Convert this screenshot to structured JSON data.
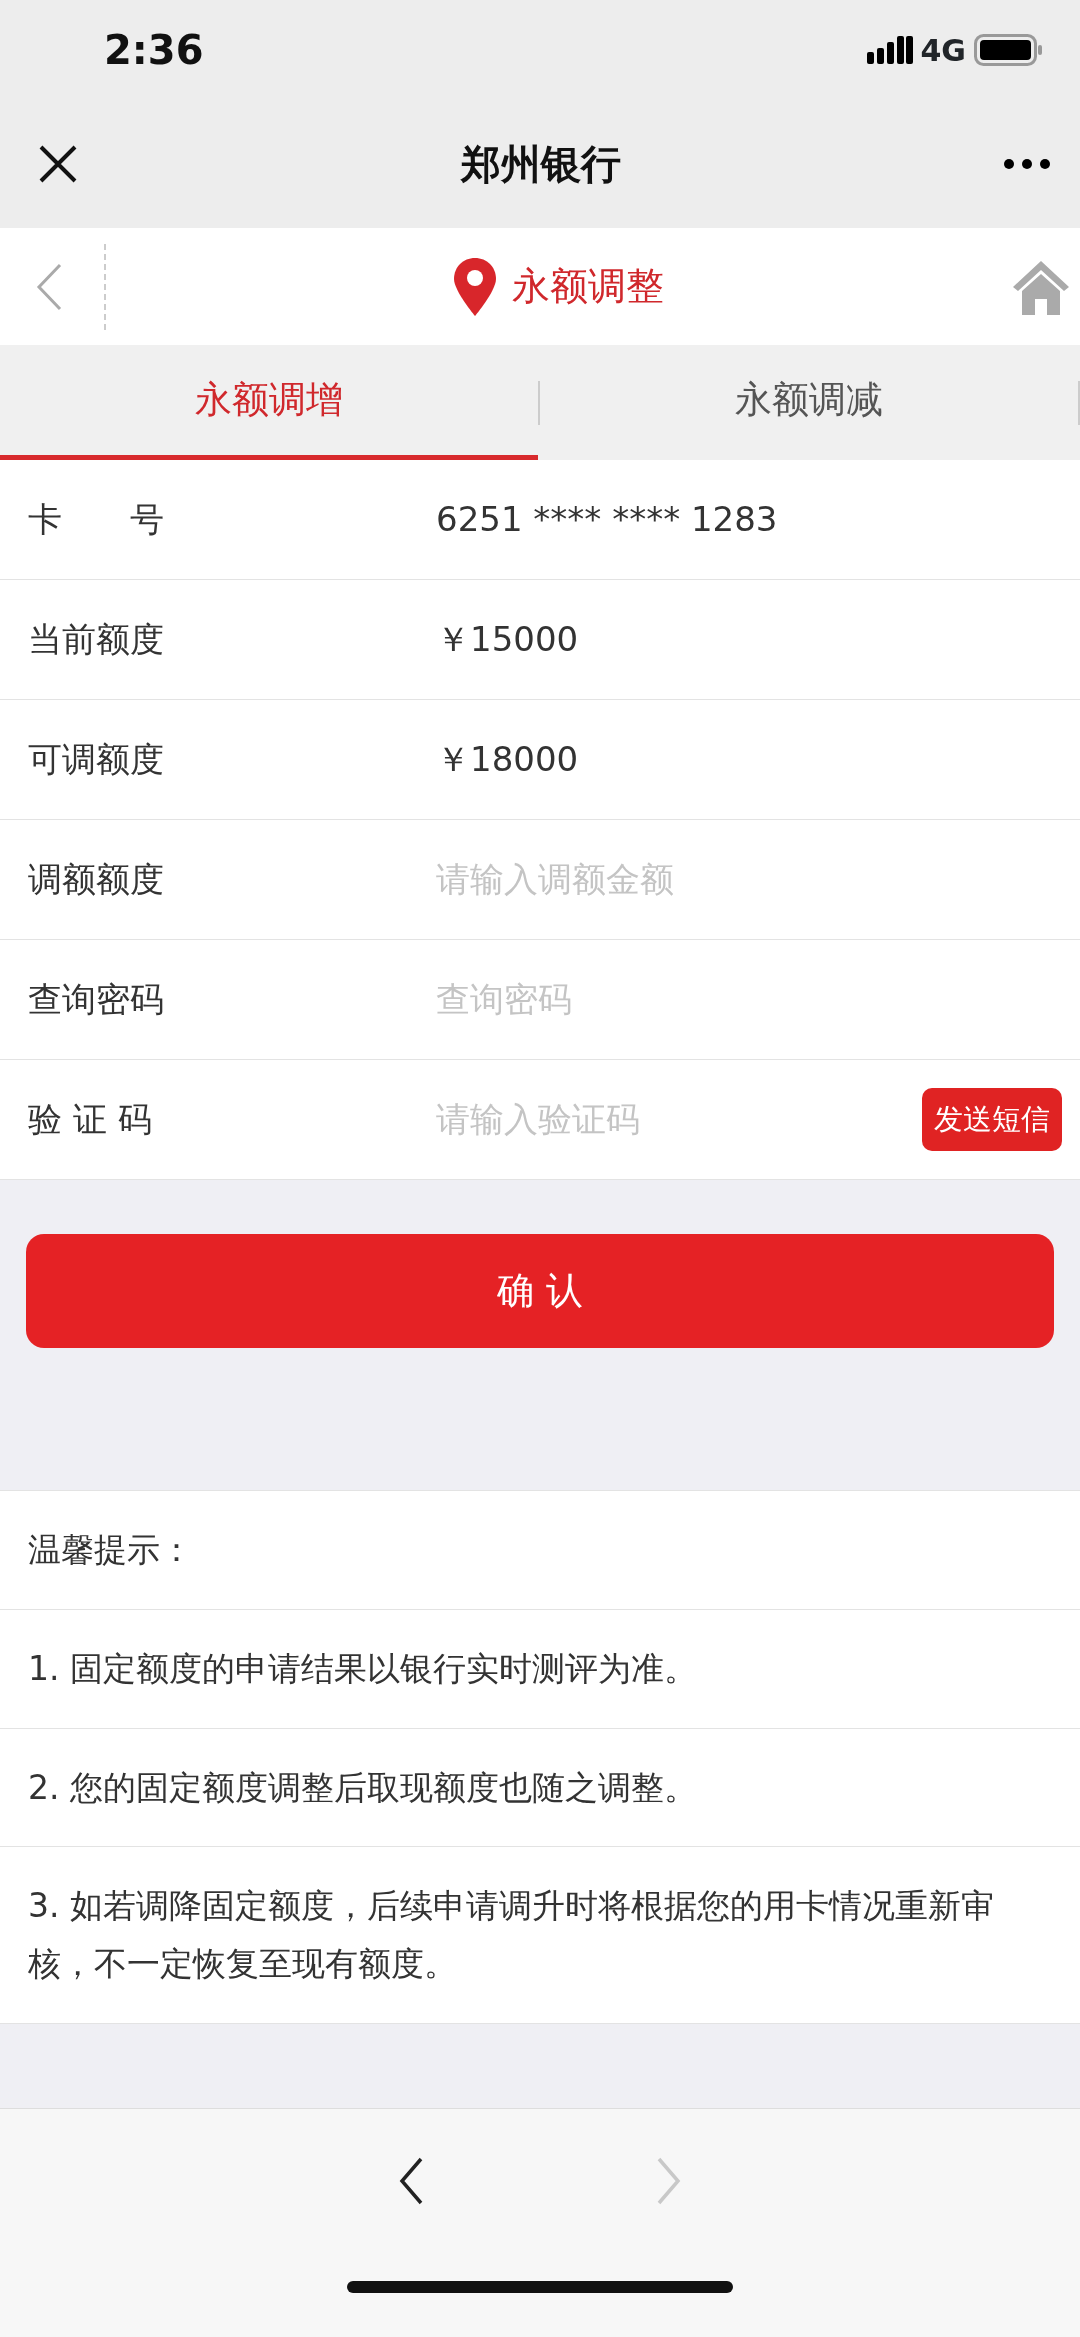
{
  "status_bar": {
    "time": "2:36",
    "network": "4G"
  },
  "title_bar": {
    "title": "郑州银行"
  },
  "page_header": {
    "title": "永额调整"
  },
  "tabs": [
    {
      "label": "永额调增",
      "selected": true
    },
    {
      "label": "永额调减",
      "selected": false
    }
  ],
  "form": [
    {
      "label": "卡　　号",
      "kind": "text",
      "value": "6251 **** **** 1283"
    },
    {
      "label": "当前额度",
      "kind": "text",
      "value": "￥15000"
    },
    {
      "label": "可调额度",
      "kind": "text",
      "value": "￥18000"
    },
    {
      "label": "调额额度",
      "kind": "input",
      "placeholder": "请输入调额金额"
    },
    {
      "label": "查询密码",
      "kind": "input",
      "placeholder": "查询密码"
    },
    {
      "label": "验 证 码",
      "kind": "input",
      "placeholder": "请输入验证码",
      "button": "发送短信"
    }
  ],
  "confirm_button": "确 认",
  "tips": {
    "title": "温馨提示：",
    "items": [
      "1. 固定额度的申请结果以银行实时测评为准。",
      "2. 您的固定额度调整后取现额度也随之调整。",
      "3. 如若调降固定额度，后续申请调升时将根据您的用卡情况重新审核，不一定恢复至现有额度。"
    ]
  },
  "bottom_nav": [
    {
      "kind": "back",
      "disabled": false
    },
    {
      "kind": "forward",
      "disabled": true
    }
  ]
}
